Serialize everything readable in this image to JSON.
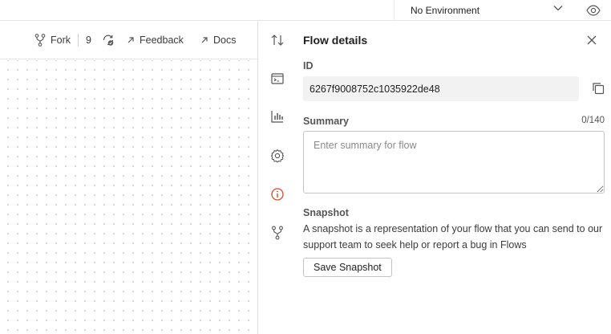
{
  "environment": {
    "selected": "No Environment"
  },
  "toolbar": {
    "fork_label": "Fork",
    "fork_count": "9",
    "feedback_label": "Feedback",
    "docs_label": "Docs"
  },
  "rail": {
    "icons": [
      "sort-arrows-icon",
      "console-icon",
      "bar-chart-icon",
      "settings-gear-icon",
      "info-icon",
      "fork-icon"
    ],
    "active_icon": "info-icon",
    "active_color": "#d14c2b"
  },
  "panel": {
    "title": "Flow details",
    "id_label": "ID",
    "id_value": "6267f9008752c1035922de48",
    "summary_label": "Summary",
    "summary_counter": "0/140",
    "summary_placeholder": "Enter summary for flow",
    "snapshot_label": "Snapshot",
    "snapshot_description": "A snapshot is a representation of your flow that you can send to our support team to seek help or report a bug in Flows",
    "save_snapshot_label": "Save Snapshot"
  }
}
